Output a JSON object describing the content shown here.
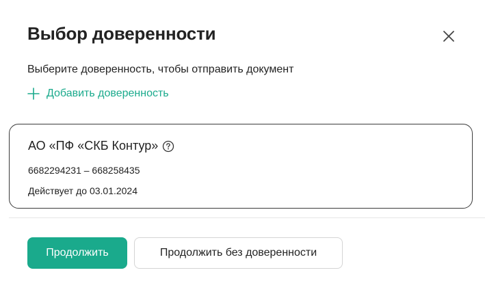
{
  "dialog": {
    "title": "Выбор доверенности",
    "close_icon": "close-icon",
    "subtitle": "Выберите доверенность, чтобы отправить документ",
    "add_link": {
      "icon": "plus-icon",
      "label": "Добавить доверенность"
    },
    "poa_card": {
      "organization": "АО «ПФ «СКБ Контур»",
      "help_icon": "question-circle-icon",
      "ids": "6682294231 – 668258435",
      "validity": "Действует до 03.01.2024"
    },
    "actions": {
      "continue_label": "Продолжить",
      "continue_without_label": "Продолжить без доверенности"
    }
  },
  "colors": {
    "accent": "#1aaa8c",
    "text": "#222222",
    "card_border": "#3a3a3a",
    "secondary_border": "#d4d4d4"
  }
}
